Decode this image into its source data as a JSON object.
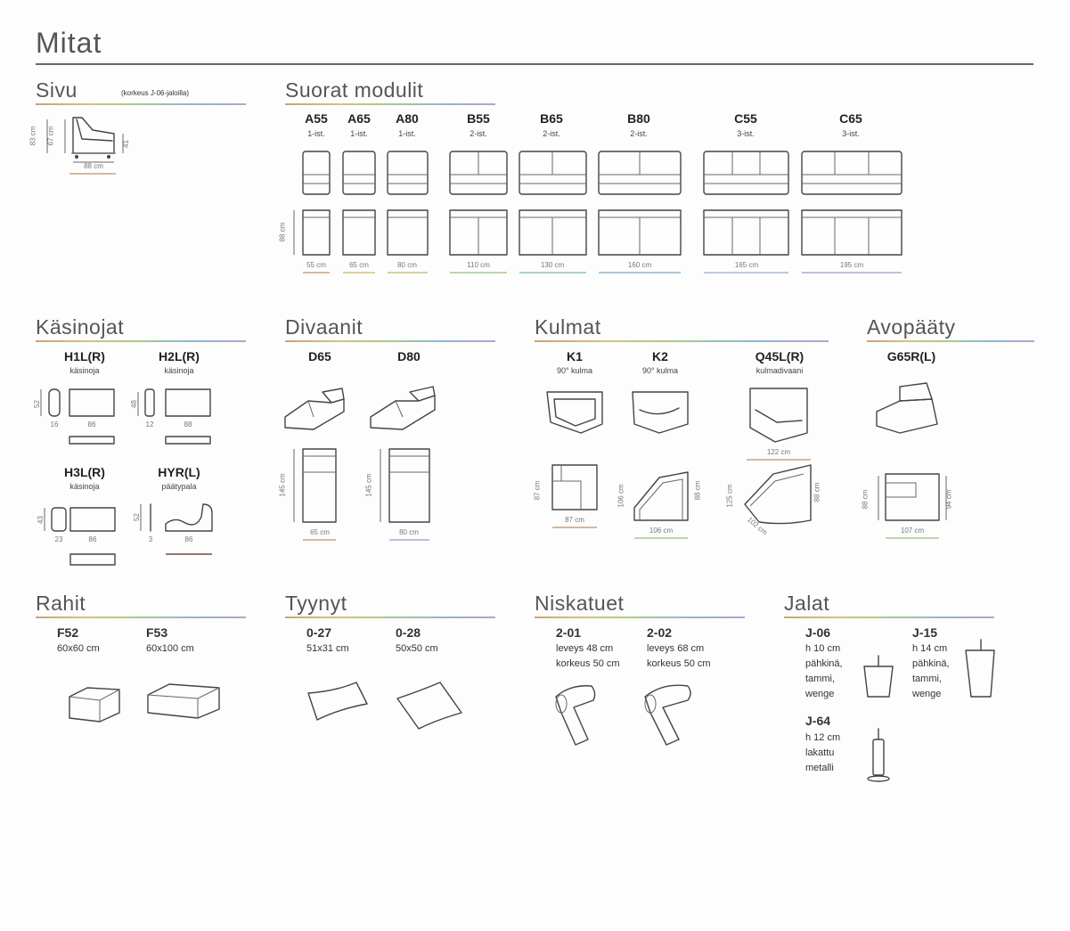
{
  "page": {
    "title": "Mitat"
  },
  "sivu": {
    "title": "Sivu",
    "note": "(korkeus J-06-jaloilla)",
    "dims": {
      "height_total": "83 cm",
      "height_seat": "67 cm",
      "height_arm": "41",
      "depth": "88 cm"
    }
  },
  "suorat": {
    "title": "Suorat modulit",
    "modules": [
      {
        "code": "A55",
        "seats": "1-ist.",
        "width": "55 cm"
      },
      {
        "code": "A65",
        "seats": "1-ist.",
        "width": "65 cm"
      },
      {
        "code": "A80",
        "seats": "1-ist.",
        "width": "80 cm"
      },
      {
        "code": "B55",
        "seats": "2-ist.",
        "width": "110 cm"
      },
      {
        "code": "B65",
        "seats": "2-ist.",
        "width": "130 cm"
      },
      {
        "code": "B80",
        "seats": "2-ist.",
        "width": "160 cm"
      },
      {
        "code": "C55",
        "seats": "3-ist.",
        "width": "165 cm"
      },
      {
        "code": "C65",
        "seats": "3-ist.",
        "width": "195 cm"
      }
    ],
    "depth": "88 cm"
  },
  "kasinojat": {
    "title": "Käsinojat",
    "items": [
      {
        "code": "H1L(R)",
        "sub": "käsinoja",
        "h": "52",
        "w1": "16",
        "w2": "86"
      },
      {
        "code": "H2L(R)",
        "sub": "käsinoja",
        "h": "48",
        "w1": "12",
        "w2": "88"
      },
      {
        "code": "H3L(R)",
        "sub": "käsinoja",
        "h": "43",
        "w1": "23",
        "w2": "86"
      },
      {
        "code": "HYR(L)",
        "sub": "päätypala",
        "h": "52",
        "w1": "3",
        "w2": "86"
      }
    ]
  },
  "divaanit": {
    "title": "Divaanit",
    "items": [
      {
        "code": "D65",
        "length": "145 cm",
        "width": "65 cm"
      },
      {
        "code": "D80",
        "length": "145 cm",
        "width": "80 cm"
      }
    ]
  },
  "kulmat": {
    "title": "Kulmat",
    "items": [
      {
        "code": "K1",
        "sub": "90° kulma",
        "d1": "87 cm",
        "d2": "87 cm"
      },
      {
        "code": "K2",
        "sub": "90° kulma",
        "d1": "106 cm",
        "d2": "88 cm",
        "d3": "106 cm"
      },
      {
        "code": "Q45L(R)",
        "sub": "kulmadivaani",
        "d1": "122 cm",
        "d2": "125 cm",
        "d3": "88 cm",
        "d4": "102 cm"
      }
    ]
  },
  "avopaady": {
    "title": "Avopääty",
    "code": "G65R(L)",
    "d1": "88 cm",
    "d2": "94 cm",
    "d3": "107 cm"
  },
  "rahit": {
    "title": "Rahit",
    "items": [
      {
        "code": "F52",
        "size": "60x60 cm"
      },
      {
        "code": "F53",
        "size": "60x100 cm"
      }
    ]
  },
  "tyynyt": {
    "title": "Tyynyt",
    "items": [
      {
        "code": "0-27",
        "size": "51x31 cm"
      },
      {
        "code": "0-28",
        "size": "50x50 cm"
      }
    ]
  },
  "niskatuet": {
    "title": "Niskatuet",
    "items": [
      {
        "code": "2-01",
        "line1": "leveys 48 cm",
        "line2": "korkeus 50 cm"
      },
      {
        "code": "2-02",
        "line1": "leveys 68 cm",
        "line2": "korkeus 50 cm"
      }
    ]
  },
  "jalat": {
    "title": "Jalat",
    "items": [
      {
        "code": "J-06",
        "lines": [
          "h 10 cm",
          "pähkinä,",
          "tammi,",
          "wenge"
        ]
      },
      {
        "code": "J-15",
        "lines": [
          "h 14 cm",
          "pähkinä,",
          "tammi,",
          "wenge"
        ]
      },
      {
        "code": "J-64",
        "lines": [
          "h 12 cm",
          "lakattu",
          "metalli"
        ]
      }
    ]
  }
}
